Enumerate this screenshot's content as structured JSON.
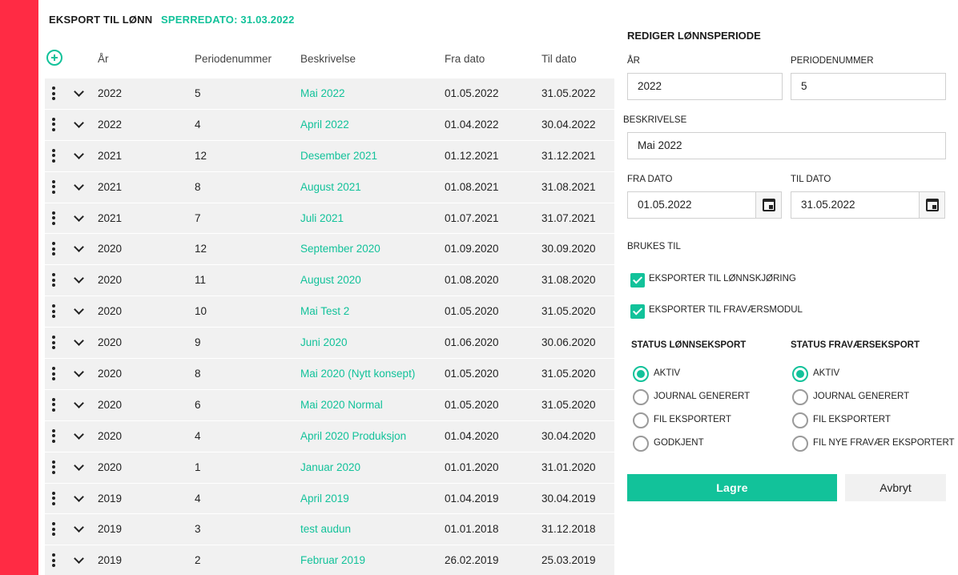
{
  "header": {
    "title": "EKSPORT TIL LØNN",
    "lock_date": "SPERREDATO: 31.03.2022"
  },
  "table": {
    "columns": [
      "År",
      "Periodenummer",
      "Beskrivelse",
      "Fra dato",
      "Til dato"
    ],
    "rows": [
      {
        "year": "2022",
        "period": "5",
        "description": "Mai 2022",
        "from": "01.05.2022",
        "to": "31.05.2022"
      },
      {
        "year": "2022",
        "period": "4",
        "description": "April 2022",
        "from": "01.04.2022",
        "to": "30.04.2022"
      },
      {
        "year": "2021",
        "period": "12",
        "description": "Desember 2021",
        "from": "01.12.2021",
        "to": "31.12.2021"
      },
      {
        "year": "2021",
        "period": "8",
        "description": "August 2021",
        "from": "01.08.2021",
        "to": "31.08.2021"
      },
      {
        "year": "2021",
        "period": "7",
        "description": "Juli 2021",
        "from": "01.07.2021",
        "to": "31.07.2021"
      },
      {
        "year": "2020",
        "period": "12",
        "description": "September 2020",
        "from": "01.09.2020",
        "to": "30.09.2020"
      },
      {
        "year": "2020",
        "period": "11",
        "description": "August 2020",
        "from": "01.08.2020",
        "to": "31.08.2020"
      },
      {
        "year": "2020",
        "period": "10",
        "description": "Mai Test 2",
        "from": "01.05.2020",
        "to": "31.05.2020"
      },
      {
        "year": "2020",
        "period": "9",
        "description": "Juni 2020",
        "from": "01.06.2020",
        "to": "30.06.2020"
      },
      {
        "year": "2020",
        "period": "8",
        "description": "Mai 2020 (Nytt konsept)",
        "from": "01.05.2020",
        "to": "31.05.2020"
      },
      {
        "year": "2020",
        "period": "6",
        "description": "Mai 2020 Normal",
        "from": "01.05.2020",
        "to": "31.05.2020"
      },
      {
        "year": "2020",
        "period": "4",
        "description": "April 2020 Produksjon",
        "from": "01.04.2020",
        "to": "30.04.2020"
      },
      {
        "year": "2020",
        "period": "1",
        "description": "Januar 2020",
        "from": "01.01.2020",
        "to": "31.01.2020"
      },
      {
        "year": "2019",
        "period": "4",
        "description": "April 2019",
        "from": "01.04.2019",
        "to": "30.04.2019"
      },
      {
        "year": "2019",
        "period": "3",
        "description": "test audun",
        "from": "01.01.2018",
        "to": "31.12.2018"
      },
      {
        "year": "2019",
        "period": "2",
        "description": "Februar 2019",
        "from": "26.02.2019",
        "to": "25.03.2019"
      }
    ]
  },
  "form": {
    "title": "REDIGER LØNNSPERIODE",
    "year_label": "ÅR",
    "year_value": "2022",
    "period_label": "PERIODENUMMER",
    "period_value": "5",
    "desc_label": "BESKRIVELSE",
    "desc_value": "Mai 2022",
    "from_label": "FRA DATO",
    "from_value": "01.05.2022",
    "to_label": "TIL DATO",
    "to_value": "31.05.2022",
    "used_for_label": "BRUKES TIL",
    "checks": [
      {
        "label": "EKSPORTER TIL LØNNSKJØRING",
        "checked": true
      },
      {
        "label": "EKSPORTER TIL FRAVÆRSMODUL",
        "checked": true
      }
    ],
    "status_pay_label": "STATUS LØNNSEKSPORT",
    "status_pay": [
      "AKTIV",
      "JOURNAL GENERERT",
      "FIL EKSPORTERT",
      "GODKJENT"
    ],
    "status_absence_label": "STATUS FRAVÆRSEKSPORT",
    "status_absence": [
      "AKTIV",
      "JOURNAL GENERERT",
      "FIL EKSPORTERT",
      "FIL NYE FRAVÆR EKSPORTERT"
    ],
    "save_label": "Lagre",
    "cancel_label": "Avbryt"
  },
  "colors": {
    "accent": "#12c29a",
    "sidebar": "#ff2b44"
  }
}
